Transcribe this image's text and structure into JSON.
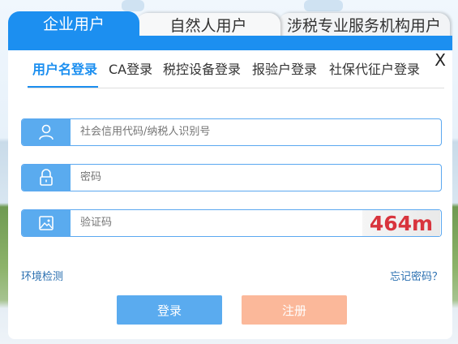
{
  "tabs": [
    {
      "label": "企业用户"
    },
    {
      "label": "自然人用户"
    },
    {
      "label": "涉税专业服务机构用户"
    }
  ],
  "close_label": "X",
  "login_methods": [
    {
      "label": "用户名登录"
    },
    {
      "label": "CA登录"
    },
    {
      "label": "税控设备登录"
    },
    {
      "label": "报验户登录"
    },
    {
      "label": "社保代征户登录"
    }
  ],
  "fields": {
    "credit_code_placeholder": "社会信用代码/纳税人识别号",
    "password_placeholder": "密码",
    "captcha_placeholder": "验证码",
    "captcha_text": "464m"
  },
  "links": {
    "environment_check": "环境检测",
    "forgot_password": "忘记密码？"
  },
  "buttons": {
    "login": "登录",
    "register": "注册"
  },
  "colors": {
    "accent": "#1c8ff0",
    "field_icon": "#5aabef",
    "register_button": "#fbb89a",
    "captcha_text": "#d8343d"
  }
}
